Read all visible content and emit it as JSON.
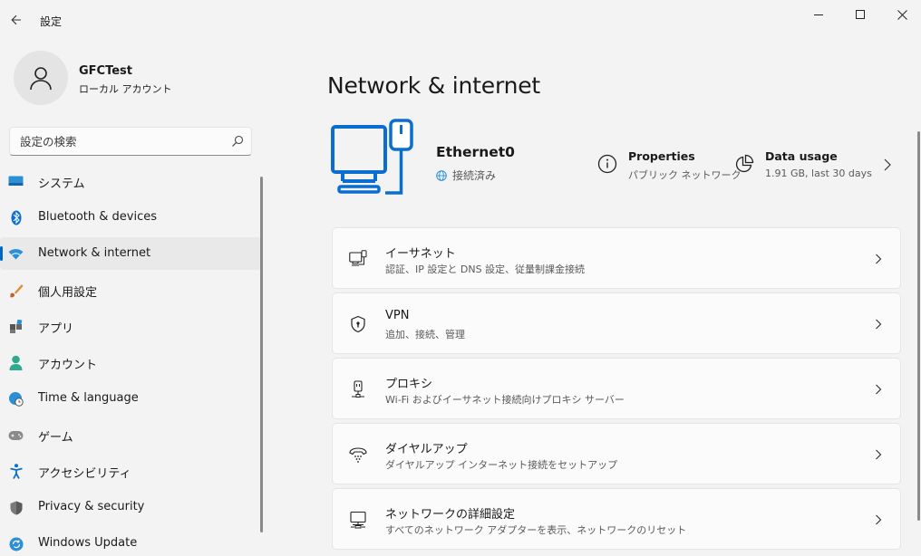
{
  "app": {
    "title": "設定"
  },
  "window_controls": [
    "minimize",
    "maximize",
    "close"
  ],
  "profile": {
    "name": "GFCTest",
    "account_type": "ローカル アカウント"
  },
  "search": {
    "placeholder": "設定の検索"
  },
  "sidebar": {
    "items": [
      {
        "label": "システム",
        "icon": "system-icon",
        "active": false
      },
      {
        "label": "Bluetooth & devices",
        "icon": "bluetooth-icon",
        "active": false
      },
      {
        "label": "Network & internet",
        "icon": "wifi-icon",
        "active": true
      },
      {
        "label": "個人用設定",
        "icon": "brush-icon",
        "active": false
      },
      {
        "label": "アプリ",
        "icon": "apps-icon",
        "active": false
      },
      {
        "label": "アカウント",
        "icon": "person-icon",
        "active": false
      },
      {
        "label": "Time & language",
        "icon": "globe-clock-icon",
        "active": false
      },
      {
        "label": "ゲーム",
        "icon": "gamepad-icon",
        "active": false
      },
      {
        "label": "アクセシビリティ",
        "icon": "accessibility-icon",
        "active": false
      },
      {
        "label": "Privacy & security",
        "icon": "shield-icon",
        "active": false
      },
      {
        "label": "Windows Update",
        "icon": "update-icon",
        "active": false
      }
    ]
  },
  "main": {
    "title": "Network & internet",
    "hero": {
      "adapter_name": "Ethernet0",
      "status": "接続済み",
      "properties": {
        "title": "Properties",
        "sub": "パブリック ネットワーク"
      },
      "data_usage": {
        "title": "Data usage",
        "sub": "1.91 GB, last 30 days"
      }
    },
    "cards": [
      {
        "title": "イーサネット",
        "sub": "認証、IP 設定と DNS 設定、従量制課金接続",
        "icon": "ethernet-icon"
      },
      {
        "title": "VPN",
        "sub": "追加、接続、管理",
        "icon": "vpn-shield-icon"
      },
      {
        "title": "プロキシ",
        "sub": "Wi-Fi およびイーサネット接続向けプロキシ サーバー",
        "icon": "proxy-icon"
      },
      {
        "title": "ダイヤルアップ",
        "sub": "ダイヤルアップ インターネット接続をセットアップ",
        "icon": "dialup-icon"
      },
      {
        "title": "ネットワークの詳細設定",
        "sub": "すべてのネットワーク アダプターを表示、ネットワークのリセット",
        "icon": "advanced-network-icon"
      }
    ]
  },
  "colors": {
    "accent": "#0067c0",
    "hero_icon": "#0a6ed1",
    "background": "#f3f3f3",
    "card": "#fbfbfb"
  }
}
